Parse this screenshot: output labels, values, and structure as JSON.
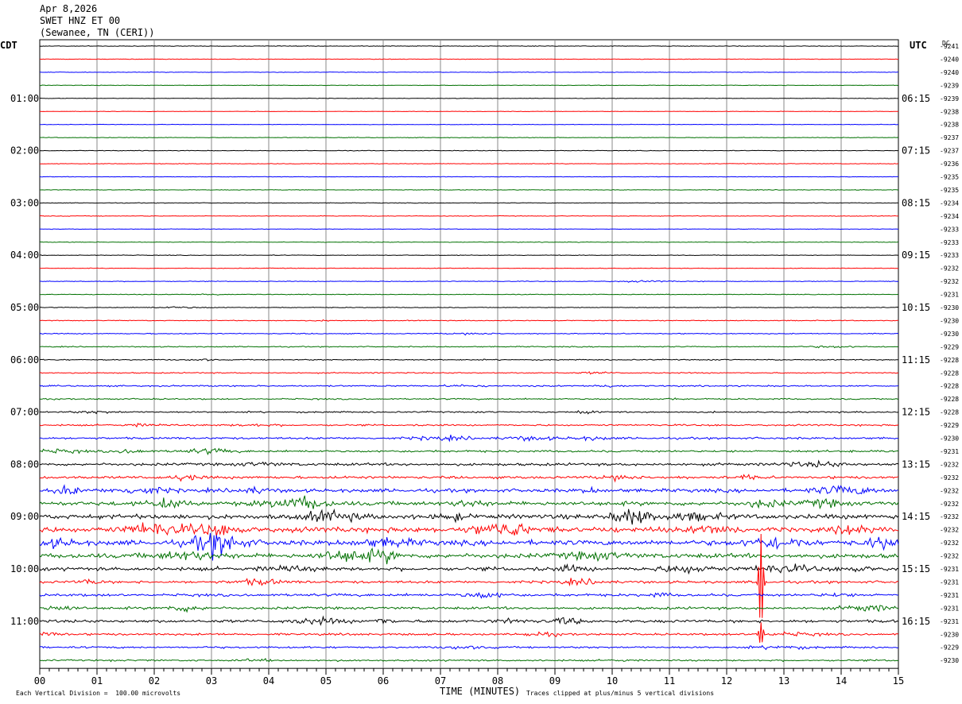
{
  "header": {
    "date": "Apr 8,2026",
    "station": "SWET HNZ ET 00",
    "location": "(Sewanee, TN (CERI))"
  },
  "left_timezone": "CDT",
  "right_timezone": "UTC",
  "dc_label": "DC",
  "footer": {
    "x_title": "TIME (MINUTES)",
    "scale_note": "Each Vertical Division =  100.00 microvolts",
    "clip_note": "Traces clipped at plus/minus 5 vertical divisions"
  },
  "chart_data": {
    "type": "line",
    "title": "",
    "xlabel": "TIME (MINUTES)",
    "xlim": [
      0,
      15
    ],
    "x_ticks": [
      "00",
      "01",
      "02",
      "03",
      "04",
      "05",
      "06",
      "07",
      "08",
      "09",
      "10",
      "11",
      "12",
      "13",
      "14",
      "15"
    ],
    "rows_per_hour": 4,
    "row_minutes": 15,
    "trace_colors": [
      "#000000",
      "#ff0000",
      "#0000ff",
      "#007000"
    ],
    "left_hour_labels": [
      "01:00",
      "02:00",
      "03:00",
      "04:00",
      "05:00",
      "06:00",
      "07:00",
      "08:00",
      "09:00",
      "10:00",
      "11:00"
    ],
    "left_label_first_row": 4,
    "right_utc_labels": [
      "06:15",
      "07:15",
      "08:15",
      "09:15",
      "10:15",
      "11:15",
      "12:15",
      "13:15",
      "14:15",
      "15:15",
      "16:15"
    ],
    "right_label_first_row": 4,
    "dc_offsets": [
      "-9241",
      "-9240",
      "-9240",
      "-9239",
      "-9239",
      "-9238",
      "-9238",
      "-9237",
      "-9237",
      "-9236",
      "-9235",
      "-9235",
      "-9234",
      "-9234",
      "-9233",
      "-9233",
      "-9233",
      "-9232",
      "-9232",
      "-9231",
      "-9230",
      "-9230",
      "-9230",
      "-9229",
      "-9228",
      "-9228",
      "-9228",
      "-9228",
      "-9228",
      "-9229",
      "-9230",
      "-9231",
      "-9232",
      "-9232",
      "-9232",
      "-9232",
      "-9232",
      "-9232",
      "-9232",
      "-9232",
      "-9231",
      "-9231",
      "-9231",
      "-9231",
      "-9231",
      "-9230",
      "-9229",
      "-9230"
    ],
    "noise_levels": [
      0.6,
      0.5,
      0.5,
      0.6,
      0.5,
      0.5,
      0.5,
      0.6,
      0.6,
      0.6,
      0.5,
      0.6,
      0.6,
      0.6,
      0.5,
      0.6,
      0.6,
      0.6,
      0.7,
      0.7,
      0.7,
      0.8,
      0.9,
      1.0,
      1.0,
      1.1,
      1.4,
      1.3,
      1.4,
      1.6,
      2.0,
      2.0,
      2.6,
      2.5,
      3.5,
      4.0,
      4.5,
      5.0,
      5.0,
      4.5,
      3.5,
      2.5,
      2.5,
      2.5,
      2.8,
      2.0,
      1.8,
      1.6
    ],
    "events": [
      {
        "row": 41,
        "minute": 12.6,
        "amplitude": 120,
        "note": "large clipped spike"
      },
      {
        "row": 45,
        "minute": 12.6,
        "amplitude": 30
      }
    ],
    "units": "microvolts",
    "division_microvolts": 100.0,
    "clip_divisions": 5
  }
}
